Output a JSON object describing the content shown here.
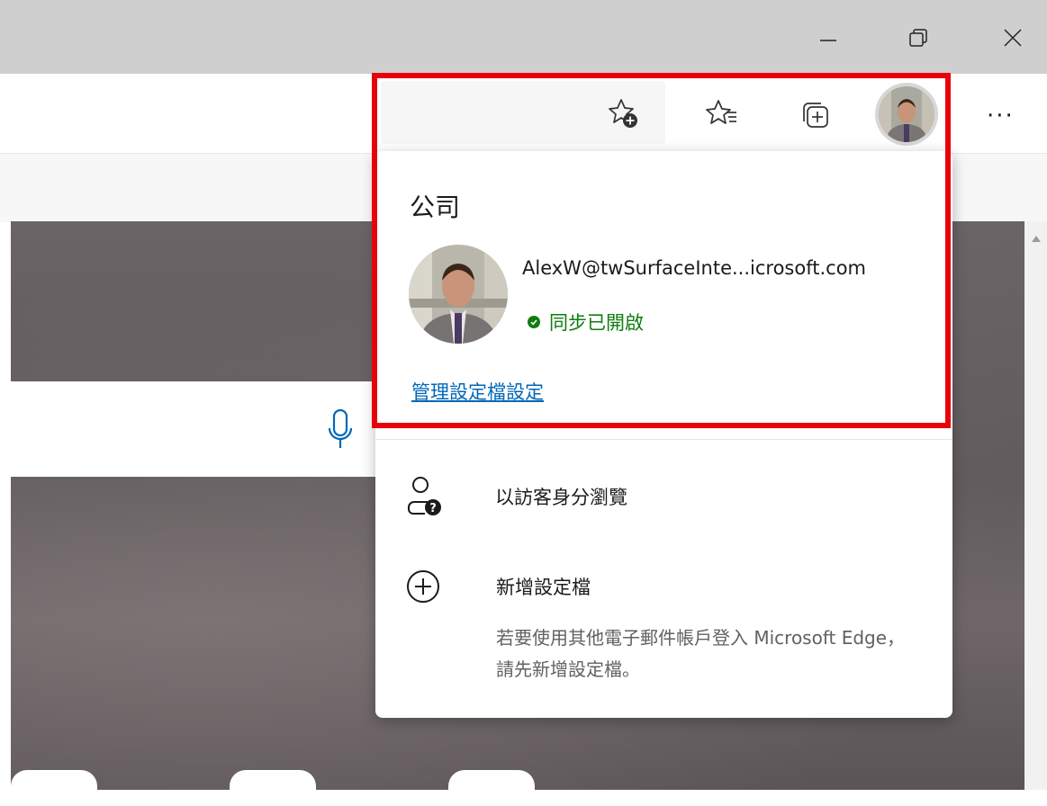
{
  "window": {
    "minimize_label": "Minimize",
    "restore_label": "Restore",
    "close_label": "Close"
  },
  "toolbar": {
    "more_label": "···",
    "icons": [
      "add-favorite-icon",
      "favorites-icon",
      "collections-icon",
      "profile-avatar-icon"
    ]
  },
  "profile_flyout": {
    "organization": "公司",
    "email": "AlexW@twSurfaceInte...icrosoft.com",
    "sync_status": "同步已開啟",
    "manage_link": "管理設定檔設定",
    "guest_label": "以訪客身分瀏覽",
    "add_profile_label": "新增設定檔",
    "add_profile_desc": "若要使用其他電子郵件帳戶登入 Microsoft Edge，請先新增設定檔。"
  },
  "colors": {
    "highlight": "#e8000b",
    "link": "#0067b8",
    "sync_green": "#107c10",
    "titlebar": "#cfcfcf"
  }
}
